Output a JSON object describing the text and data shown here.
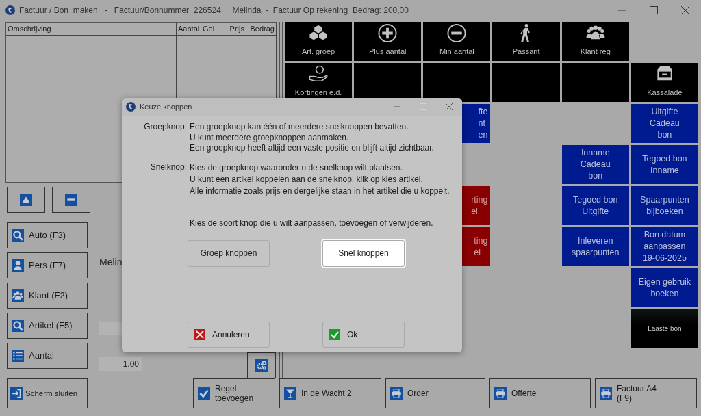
{
  "window": {
    "title": "Factuur / Bon  maken   -   Factuur/Bonnummer  226524     Melinda  -  Factuur Op rekening  Bedrag: 200,00"
  },
  "table": {
    "columns": [
      "Omschrijving",
      "Aantal",
      "Gel",
      "Prijs",
      "Bedrag"
    ]
  },
  "side_buttons": [
    "Auto (F3)",
    "Pers (F7)",
    "Klant (F2)",
    "Artikel (F5)",
    "Aantal"
  ],
  "customer_name": "Melin",
  "quantity_field": {
    "value": "1.00"
  },
  "tiles": [
    [
      {
        "kind": "black",
        "label": "Art. groep"
      },
      {
        "kind": "black",
        "label": "Plus aantal"
      },
      {
        "kind": "black",
        "label": "Min aantal"
      },
      {
        "kind": "black",
        "label": "Passant"
      },
      {
        "kind": "black",
        "label": "Klant reg"
      },
      {
        "kind": "empty"
      }
    ],
    [
      {
        "kind": "black",
        "label": "Kortingen e.d."
      },
      {
        "kind": "black"
      },
      {
        "kind": "black"
      },
      {
        "kind": "black"
      },
      {
        "kind": "black"
      },
      {
        "kind": "black",
        "label": "Kassalade"
      }
    ],
    [
      {
        "kind": "empty"
      },
      {
        "kind": "empty"
      },
      {
        "kind": "blue",
        "label": "fte\nnt\nen"
      },
      {
        "kind": "empty"
      },
      {
        "kind": "empty"
      },
      {
        "kind": "blue",
        "label": "Uitgifte\nCadeau\nbon"
      }
    ],
    [
      {
        "kind": "empty"
      },
      {
        "kind": "empty"
      },
      {
        "kind": "empty"
      },
      {
        "kind": "empty"
      },
      {
        "kind": "blue",
        "label": "Inname\nCadeau\nbon"
      },
      {
        "kind": "blue",
        "label": "Tegoed bon\nInname"
      }
    ],
    [
      {
        "kind": "empty"
      },
      {
        "kind": "empty"
      },
      {
        "kind": "red",
        "label": "rting\nel"
      },
      {
        "kind": "empty"
      },
      {
        "kind": "blue",
        "label": "Tegoed bon\nUitgifte"
      },
      {
        "kind": "blue",
        "label": "Spaarpunten\nbijboeken"
      }
    ],
    [
      {
        "kind": "empty"
      },
      {
        "kind": "empty"
      },
      {
        "kind": "red",
        "label": "ting\nel"
      },
      {
        "kind": "empty"
      },
      {
        "kind": "blue",
        "label": "Inleveren\nspaarpunten"
      },
      {
        "kind": "blue",
        "label": "Bon datum\naanpassen\n19-06-2025"
      }
    ],
    [
      {
        "kind": "empty"
      },
      {
        "kind": "empty"
      },
      {
        "kind": "empty"
      },
      {
        "kind": "empty"
      },
      {
        "kind": "empty"
      },
      {
        "kind": "blue",
        "label": "Eigen gebruik\nboeken"
      }
    ],
    [
      {
        "kind": "empty"
      },
      {
        "kind": "empty"
      },
      {
        "kind": "empty"
      },
      {
        "kind": "empty"
      },
      {
        "kind": "empty"
      },
      {
        "kind": "dark",
        "label": "Laaste bon"
      }
    ]
  ],
  "bottom_buttons": [
    "Scherm sluiten",
    "Regel\ntoevoegen",
    "In de Wacht 2",
    "Order",
    "Offerte",
    "Factuur A4\n(F9)"
  ],
  "dialog": {
    "title": "Keuze knoppen",
    "sections": [
      {
        "label": "Groepknop:",
        "lines": [
          "Een groepknop kan één of meerdere snelknoppen bevatten.",
          "U kunt meerdere groepknoppen aanmaken.",
          "Een groepknop heeft altijd een vaste positie en blijft altijd zichtbaar."
        ]
      },
      {
        "label": "Snelknop:",
        "lines": [
          "Kies de groepknop waaronder u de snelknop wilt plaatsen.",
          "U kunt een artikel koppelen aan de snelknop, klik op kies artikel.",
          "Alle informatie zoals prijs en dergelijke staan in het artikel die u koppelt."
        ]
      }
    ],
    "prompt": "Kies de soort knop die u wilt aanpassen, toevoegen of verwijderen.",
    "choices": [
      {
        "label": "Groep knoppen",
        "selected": false
      },
      {
        "label": "Snel knoppen",
        "selected": true
      }
    ],
    "actions": [
      {
        "kind": "cancel",
        "label": "Annuleren"
      },
      {
        "kind": "ok",
        "label": "Ok"
      }
    ]
  }
}
